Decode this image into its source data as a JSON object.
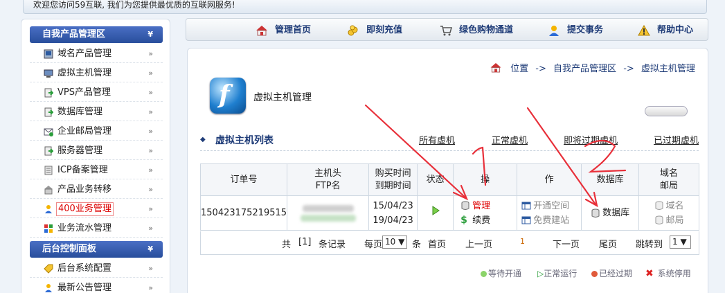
{
  "topbar": {
    "welcome": "欢迎您访问59互联, 我们为您提供最优质的互联网服务!"
  },
  "sidebar": {
    "section1": {
      "title": "自我产品管理区",
      "arrow": "»"
    },
    "items": [
      {
        "label": "域名产品管理",
        "icon": "domain-icon"
      },
      {
        "label": "虚拟主机管理",
        "icon": "host-icon"
      },
      {
        "label": "VPS产品管理",
        "icon": "vps-icon"
      },
      {
        "label": "数据库管理",
        "icon": "database-icon"
      },
      {
        "label": "企业邮局管理",
        "icon": "mail-icon"
      },
      {
        "label": "服务器管理",
        "icon": "server-icon"
      },
      {
        "label": "ICP备案管理",
        "icon": "icp-icon"
      },
      {
        "label": "产品业务转移",
        "icon": "transfer-icon"
      },
      {
        "label": "400业务管理",
        "icon": "user-icon"
      },
      {
        "label": "业务流水管理",
        "icon": "grid-icon"
      }
    ],
    "section2": {
      "title": "后台控制面板",
      "arrow": "»"
    },
    "items2": [
      {
        "label": "后台系统配置",
        "icon": "tag-icon"
      },
      {
        "label": "最新公告管理",
        "icon": "user-icon"
      }
    ],
    "item_arrow": "»"
  },
  "nav": {
    "items": [
      {
        "label": "管理首页",
        "icon": "home-icon"
      },
      {
        "label": "即刻充值",
        "icon": "coins-icon"
      },
      {
        "label": "绿色购物通道",
        "icon": "cart-icon"
      },
      {
        "label": "提交事务",
        "icon": "user-icon"
      },
      {
        "label": "帮助中心",
        "icon": "warning-icon"
      }
    ]
  },
  "breadcrumb": {
    "pos": "位置",
    "sep": "->",
    "level1": "自我产品管理区",
    "level2": "虚拟主机管理"
  },
  "page": {
    "title": "虚拟主机管理"
  },
  "list": {
    "title": "虚拟主机列表",
    "filters": [
      "所有虚机",
      "正常虚机",
      "即将过期虚机",
      "已过期虚机"
    ]
  },
  "table": {
    "headers": {
      "order": "订单号",
      "host_a": "主机头",
      "host_b": "FTP名",
      "date_a": "购买时间",
      "date_b": "到期时间",
      "status": "状态",
      "op_a": "操",
      "op_b": "作",
      "db": "数据库",
      "dm_a": "域名",
      "dm_b": "邮局"
    },
    "row": {
      "order": "150423175219515",
      "buy": "15/04/23",
      "expire": "19/04/23",
      "op_manage": "管理",
      "op_renew": "续费",
      "op_open": "开通空间",
      "op_site": "免费建站",
      "db": "数据库",
      "domain": "域名",
      "mail": "邮局"
    }
  },
  "pager": {
    "total_pre": "共",
    "total": "[1]",
    "total_suf": "条记录",
    "per_pre": "每页",
    "per": "10 ▼",
    "per_suf": "条",
    "first": "首页",
    "prev": "上一页",
    "cur": "1",
    "next": "下一页",
    "last": "尾页",
    "jump": "跳转到",
    "jump_val": "1 ▼"
  },
  "legend": {
    "waiting": "等待开通",
    "running": "正常运行",
    "expired": "已经过期",
    "stopped": "系统停用"
  },
  "colors": {
    "accent": "#1f3c78",
    "header": "#284e9c",
    "annotation": "#e8303a"
  }
}
